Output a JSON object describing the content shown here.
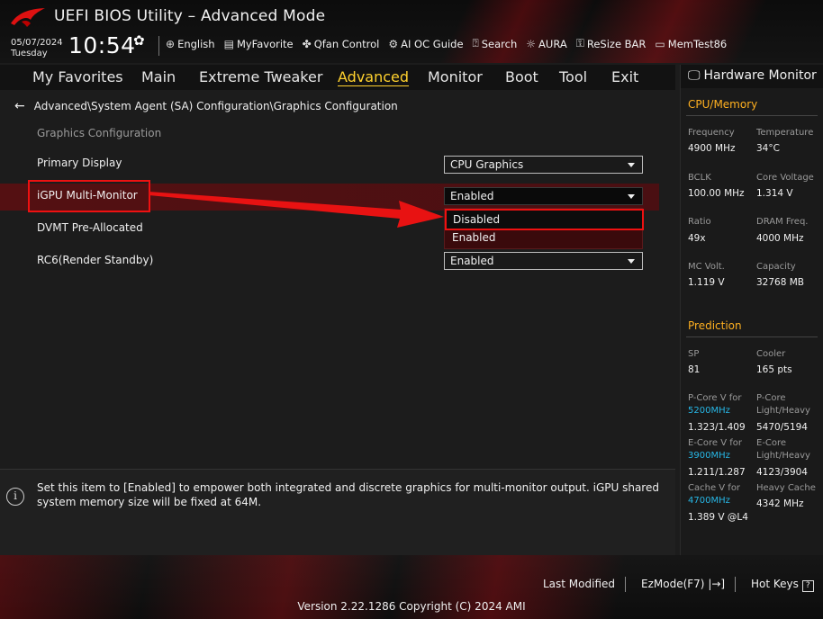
{
  "header": {
    "title": "UEFI BIOS Utility – Advanced Mode",
    "date": "05/07/2024",
    "day": "Tuesday",
    "time": "10:54",
    "toolbar": [
      {
        "icon": "globe-icon",
        "label": "English"
      },
      {
        "icon": "favorite-icon",
        "label": "MyFavorite"
      },
      {
        "icon": "fan-icon",
        "label": "Qfan Control"
      },
      {
        "icon": "ai-icon",
        "label": "AI OC Guide"
      },
      {
        "icon": "search-icon",
        "label": "Search"
      },
      {
        "icon": "aura-icon",
        "label": "AURA"
      },
      {
        "icon": "resize-bar-icon",
        "label": "ReSize BAR"
      },
      {
        "icon": "memtest-icon",
        "label": "MemTest86"
      }
    ]
  },
  "tabs": [
    "My Favorites",
    "Main",
    "Extreme Tweaker",
    "Advanced",
    "Monitor",
    "Boot",
    "Tool",
    "Exit"
  ],
  "active_tab": "Advanced",
  "main": {
    "breadcrumb": "Advanced\\System Agent (SA) Configuration\\Graphics Configuration",
    "section": "Graphics Configuration",
    "rows": [
      {
        "label": "Primary Display",
        "value": "CPU Graphics"
      },
      {
        "label": "iGPU Multi-Monitor",
        "value": "Enabled"
      },
      {
        "label": "DVMT Pre-Allocated",
        "value": ""
      },
      {
        "label": "RC6(Render Standby)",
        "value": "Enabled"
      }
    ],
    "dropdown_options": [
      "Disabled",
      "Enabled"
    ],
    "dropdown_selected": "Disabled"
  },
  "help": {
    "text": "Set this item to [Enabled] to empower both integrated and discrete graphics for multi-monitor output. iGPU shared system memory size will be fixed at 64M."
  },
  "hardware_monitor": {
    "title": "Hardware Monitor",
    "cpu_memory_title": "CPU/Memory",
    "cpu_memory": [
      {
        "label": "Frequency",
        "value": "4900 MHz"
      },
      {
        "label": "Temperature",
        "value": "34°C"
      },
      {
        "label": "BCLK",
        "value": "100.00 MHz"
      },
      {
        "label": "Core Voltage",
        "value": "1.314 V"
      },
      {
        "label": "Ratio",
        "value": "49x"
      },
      {
        "label": "DRAM Freq.",
        "value": "4000 MHz"
      },
      {
        "label": "MC Volt.",
        "value": "1.119 V"
      },
      {
        "label": "Capacity",
        "value": "32768 MB"
      }
    ],
    "prediction_title": "Prediction",
    "prediction": {
      "sp_label": "SP",
      "sp_value": "81",
      "cooler_label": "Cooler",
      "cooler_value": "165 pts",
      "pcore_v_label": "P-Core V for",
      "pcore_v_freq": "5200MHz",
      "pcore_v_value": "1.323/1.409",
      "pcore_lh_label": "P-Core",
      "pcore_lh_label2": "Light/Heavy",
      "pcore_lh_value": "5470/5194",
      "ecore_v_label": "E-Core V for",
      "ecore_v_freq": "3900MHz",
      "ecore_v_value": "1.211/1.287",
      "ecore_lh_label": "E-Core",
      "ecore_lh_label2": "Light/Heavy",
      "ecore_lh_value": "4123/3904",
      "cache_v_label": "Cache V for",
      "cache_v_freq": "4700MHz",
      "cache_v_value": "1.389 V @L4",
      "heavy_cache_label": "Heavy Cache",
      "heavy_cache_value": "4342 MHz"
    }
  },
  "footer": {
    "last_modified": "Last Modified",
    "ezmode": "EzMode(F7)",
    "hotkeys": "Hot Keys",
    "version": "Version 2.22.1286 Copyright (C) 2024 AMI"
  },
  "colors": {
    "accent": "#ffd12e",
    "highlight_red": "#e11111",
    "section_orange": "#ffb020",
    "cyan": "#27b7e6"
  }
}
